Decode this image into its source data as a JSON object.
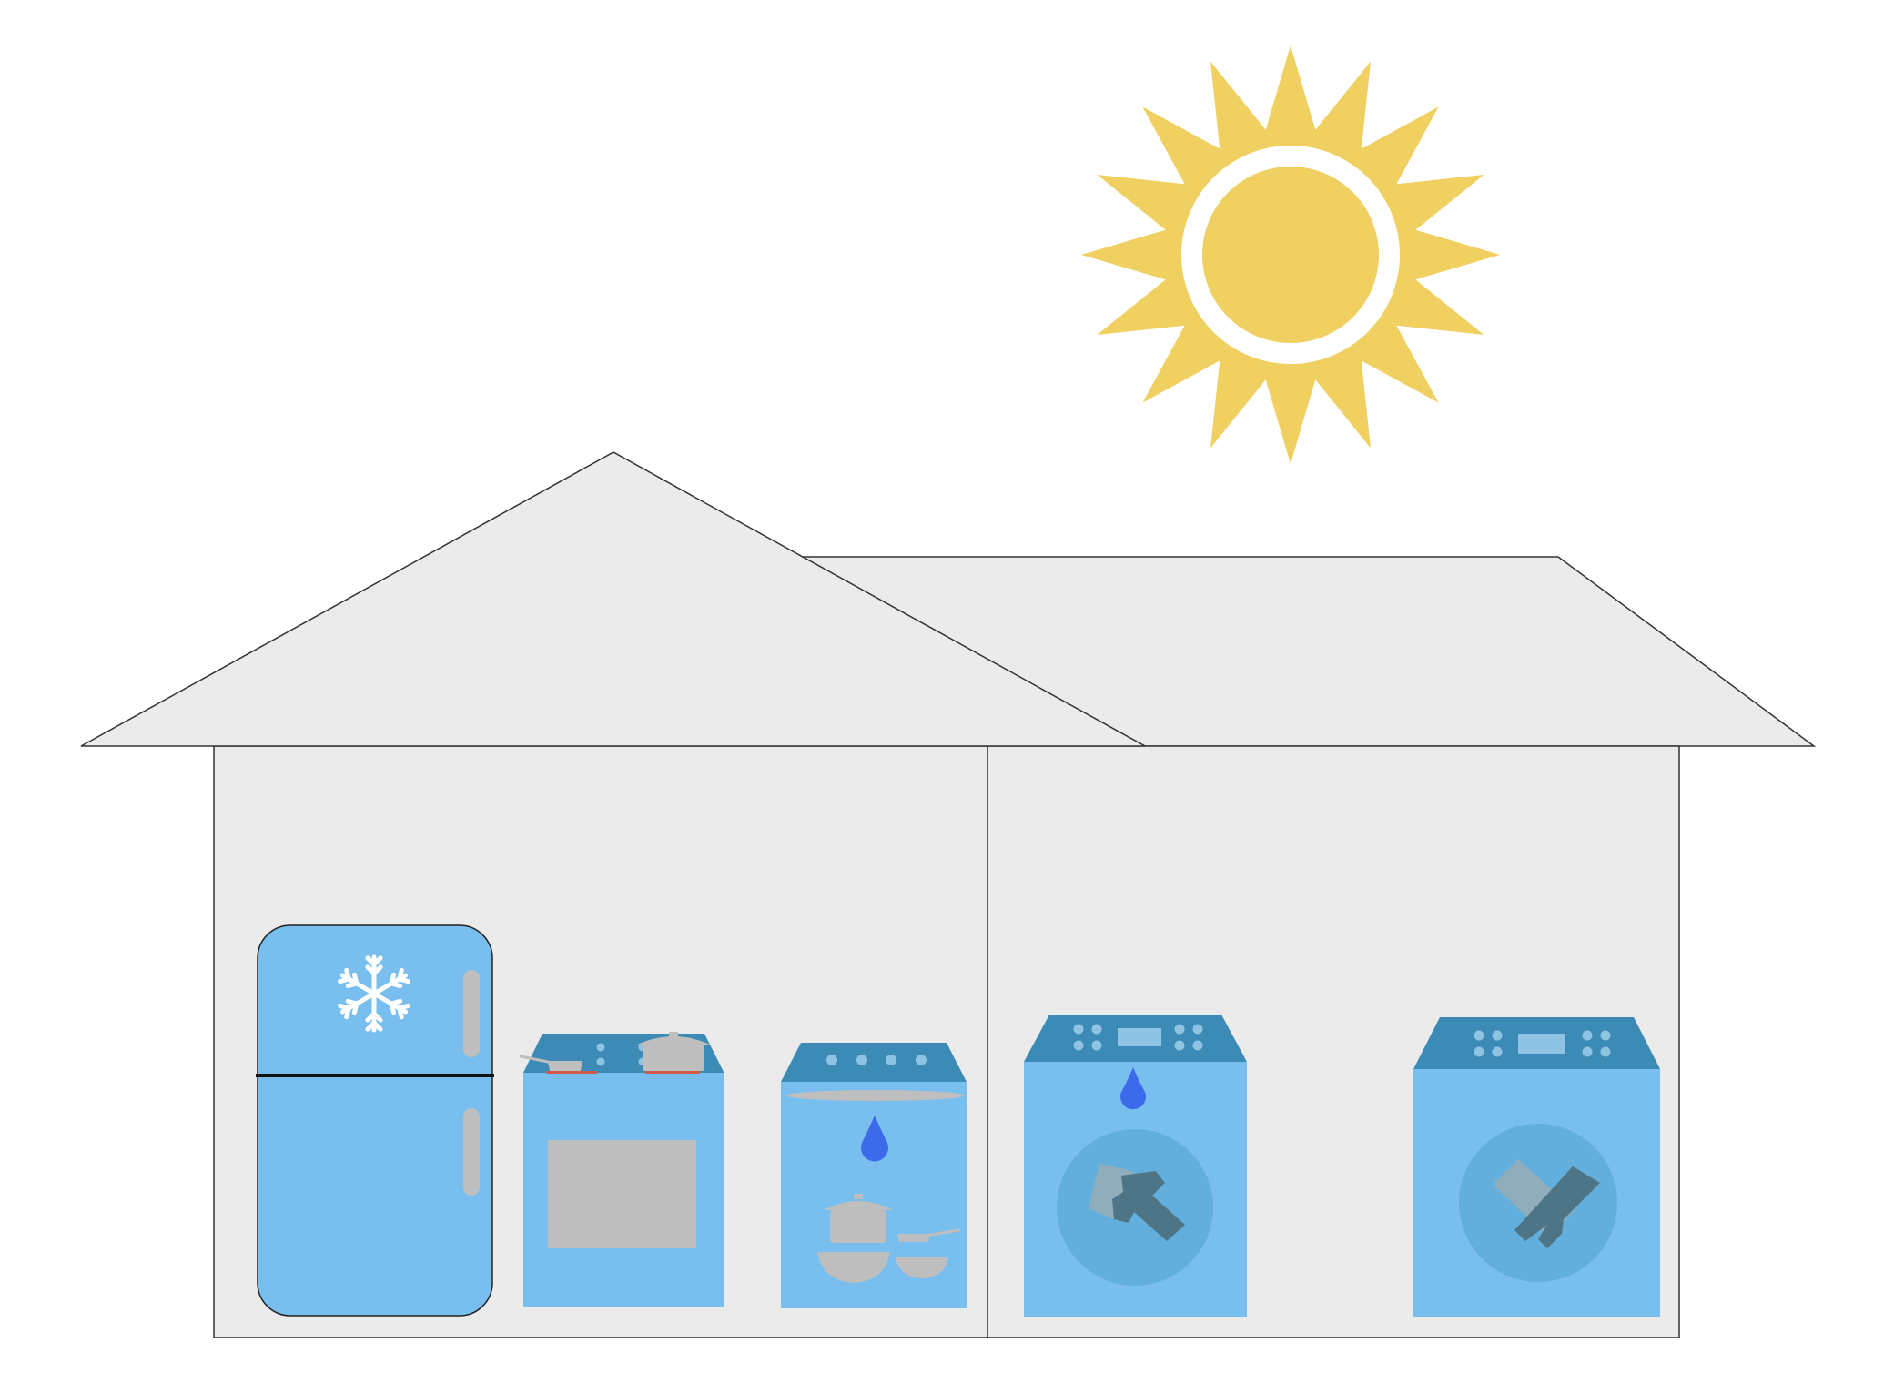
{
  "scene": {
    "sky_icon": "sun-icon",
    "house": {
      "rooms": [
        {
          "name": "kitchen",
          "appliances": [
            {
              "kind": "refrigerator",
              "icon": "snowflake-icon"
            },
            {
              "kind": "stove-oven",
              "icon": "cookware-icon"
            },
            {
              "kind": "dishwasher",
              "icon": "water-drop-icon"
            }
          ]
        },
        {
          "name": "laundry",
          "appliances": [
            {
              "kind": "washing-machine",
              "icon": "water-drop-icon"
            },
            {
              "kind": "clothes-dryer",
              "icon": "clothes-icon"
            }
          ]
        }
      ]
    }
  },
  "colors": {
    "sun": "#EFD060",
    "house_fill": "#EBEBEB",
    "outline": "#333333",
    "appliance_body": "#78BFF0",
    "appliance_top": "#3C8AB6",
    "knob": "#8FC3E4",
    "pot_grey": "#BEBEBE",
    "water_drop": "#3B6BEA",
    "drum": "#62AEDC",
    "clothes_dark": "#4E7585",
    "clothes_light": "#8FADBA",
    "snowflake": "#FFFFFF",
    "burner_red": "#D25A4A"
  }
}
